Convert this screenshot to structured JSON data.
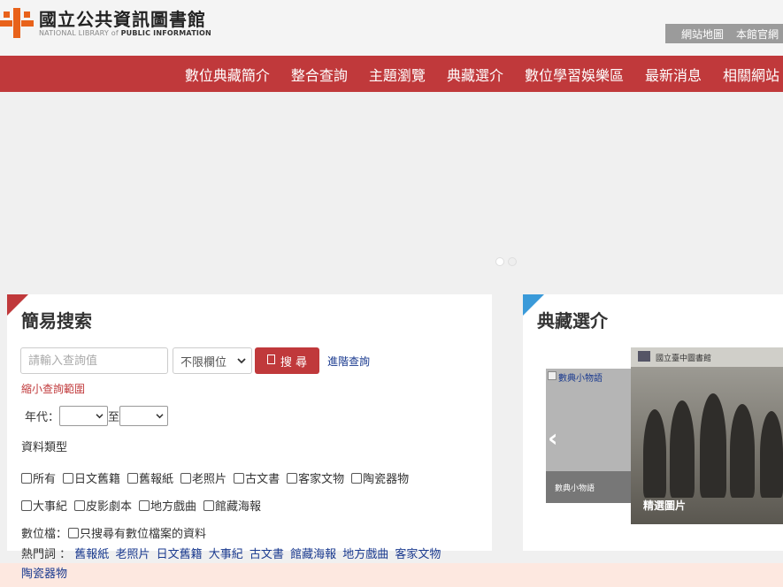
{
  "header": {
    "logo_zh": "國立公共資訊圖書館",
    "logo_en_prefix": "NATIONAL LIBRARY of ",
    "logo_en_strong": "PUBLIC INFORMATION",
    "toplinks": [
      "網站地圖",
      "本館官網"
    ]
  },
  "nav": {
    "items": [
      "數位典藏簡介",
      "整合查詢",
      "主題瀏覽",
      "典藏選介",
      "數位學習娛樂區",
      "最新消息",
      "相關網站"
    ]
  },
  "search": {
    "title": "簡易搜索",
    "placeholder": "請輸入查詢值",
    "field_select": "不限欄位",
    "button_label": "搜 尋",
    "advanced_link": "進階查詢",
    "narrow_link": "縮小查詢範圍",
    "year_label": "年代：",
    "year_to": "至",
    "type_label": "資料類型",
    "types_row1": [
      "所有",
      "日文舊籍",
      "舊報紙",
      "老照片",
      "古文書",
      "客家文物",
      "陶瓷器物"
    ],
    "types_row2": [
      "大事紀",
      "皮影劇本",
      "地方戲曲",
      "館藏海報"
    ],
    "digital_label": "數位檔：",
    "digital_option": "只搜尋有數位檔案的資料"
  },
  "hot": {
    "label": "熱門詞 ：",
    "terms": [
      "舊報紙",
      "老照片",
      "日文舊籍",
      "大事紀",
      "古文書",
      "館藏海報",
      "地方戲曲",
      "客家文物",
      "陶瓷器物"
    ]
  },
  "collection": {
    "title": "典藏選介",
    "back_alt": "數典小物語",
    "back_caption": "數典小物語",
    "front_header": "國立臺中圖書館",
    "front_caption": "精選圖片"
  },
  "colors": {
    "brand_red": "#c0393b",
    "accent_blue": "#3a9ad9",
    "link_blue": "#1a3a8f"
  }
}
